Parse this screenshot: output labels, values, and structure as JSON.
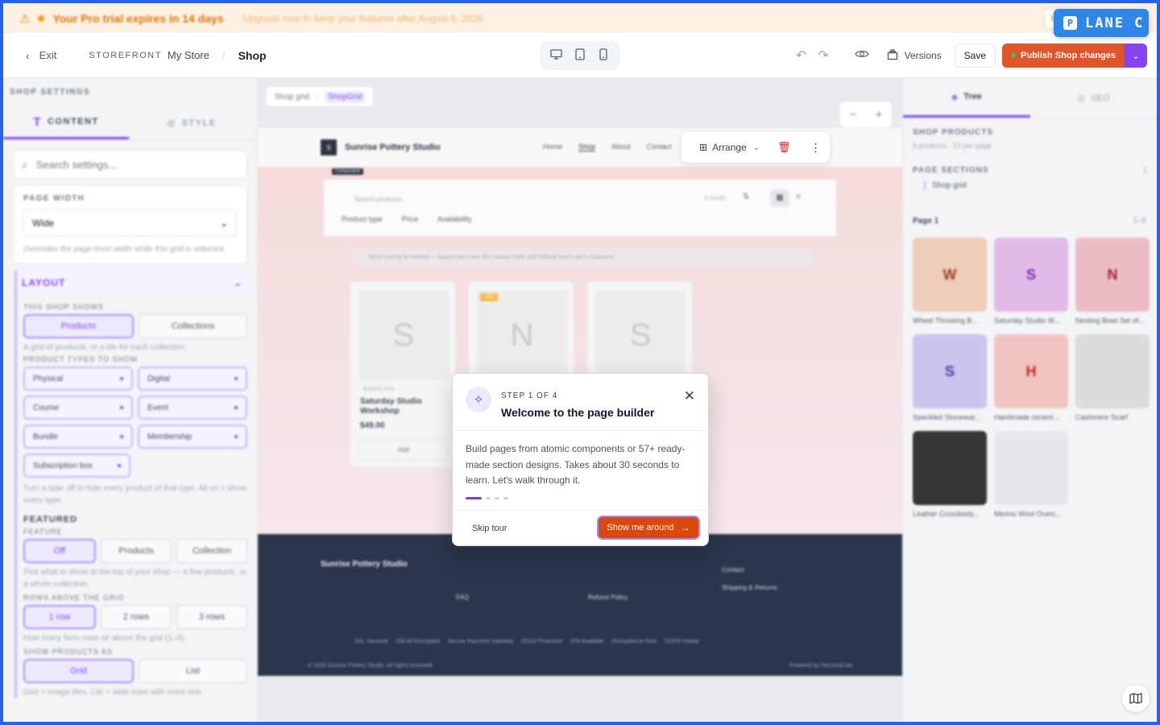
{
  "banner": {
    "message": "Your Pro trial expires in 14 days",
    "sub": "Upgrade now to keep your features after August 6, 2026",
    "upgrade": "Up"
  },
  "lane": {
    "label": "LANE C",
    "icon": "P"
  },
  "topbar": {
    "exit": "Exit",
    "storefront": "STOREFRONT",
    "store": "My Store",
    "page": "Shop",
    "versions": "Versions",
    "save": "Save",
    "publish": "Publish Shop changes"
  },
  "left": {
    "header": "SHOP SETTINGS",
    "tab_content": "CONTENT",
    "tab_style": "STYLE",
    "search_placeholder": "Search settings...",
    "page_width_label": "PAGE WIDTH",
    "page_width_value": "Wide",
    "page_width_hint": "Overrides the page-level width while this grid is selected.",
    "layout_label": "LAYOUT",
    "shows_label": "THIS SHOP SHOWS",
    "shows_options": [
      "Products",
      "Collections"
    ],
    "shows_hint": "A grid of products, or a tile for each collection.",
    "types_label": "PRODUCT TYPES TO SHOW",
    "types": [
      "Physical",
      "Digital",
      "Course",
      "Event",
      "Bundle",
      "Membership",
      "Subscription box"
    ],
    "types_hint": "Turn a type off to hide every product of that type. All on = show every type.",
    "featured_label": "FEATURED",
    "feature_label": "FEATURE",
    "feature_options": [
      "Off",
      "Products",
      "Collection"
    ],
    "feature_hint": "Pick what to show at the top of your shop — a few products, or a whole collection.",
    "rows_label": "ROWS ABOVE THE GRID",
    "rows_options": [
      "1 row",
      "2 rows",
      "3 rows"
    ],
    "rows_hint": "How many hero rows sit above the grid (1–3).",
    "showas_label": "SHOW PRODUCTS AS",
    "showas_options": [
      "Grid",
      "List"
    ],
    "showas_hint": "Grid = image tiles. List = wide rows with more text."
  },
  "canvas": {
    "breadcrumb": [
      "Shop grid",
      "ShopGrid"
    ],
    "zoom_minus": "−",
    "zoom_plus": "+",
    "arrange": "Arrange",
    "site_name": "Sunrise Pottery Studio",
    "site_logo": "S",
    "nav": [
      "Home",
      "Shop",
      "About",
      "Contact"
    ],
    "component_tag": "Component",
    "search_placeholder": "Search products...",
    "results": "3 results",
    "filters": [
      "Product type",
      "Price",
      "Availability"
    ],
    "sort_note": "You're sorting by Newest — buyers won't see this manual order until Default sort is set to Featured.",
    "products": [
      {
        "letter": "S",
        "tag": "BOOKING",
        "title": "Saturday Studio Workshop",
        "price": "$49.00",
        "add": "Add"
      },
      {
        "letter": "N",
        "sale": "-15%"
      },
      {
        "letter": "S"
      }
    ],
    "footer": {
      "name": "Sunrise Pottery Studio",
      "contact": "Contact",
      "shipping": "Shipping & Returns",
      "faq": "FAQ",
      "refund": "Refund Policy",
      "badges": [
        "SSL Secured",
        "256-bit Encrypted",
        "Secure Payment Gateway",
        "DDoS Protected",
        "2FA Available",
        "Encrypted at Rest",
        "GDPR Ready"
      ],
      "copyright": "© 2026 Sunrise Pottery Studio. All rights reserved.",
      "powered": "Powered by PersonaCart"
    }
  },
  "right": {
    "tab_tree": "Tree",
    "tab_seo": "SEO",
    "shop_products": "SHOP PRODUCTS",
    "shop_products_sub": "8 products · 12 per page",
    "page_sections": "PAGE SECTIONS",
    "page_sections_count": "1",
    "section_item": "Shop grid",
    "page_label": "Page 1",
    "page_range": "1–8",
    "thumbs": [
      {
        "letter": "W",
        "caption": "Wheel Throwing B...",
        "bg": "#ecc9b4",
        "fg": "#9a3412"
      },
      {
        "letter": "S",
        "caption": "Saturday Studio W...",
        "bg": "#e0b6e6",
        "fg": "#6b21a8"
      },
      {
        "letter": "N",
        "caption": "Nesting Bowl Set of...",
        "bg": "#eab8c0",
        "fg": "#9f1239"
      },
      {
        "letter": "S",
        "caption": "Speckled Stonewar...",
        "bg": "#c9c0ee",
        "fg": "#3730a3"
      },
      {
        "letter": "H",
        "caption": "Handmade cerami...",
        "bg": "#f0c2bd",
        "fg": "#b91c1c"
      },
      {
        "letter": "",
        "caption": "Cashmere Scarf",
        "bg": "#d9dadc",
        "fg": "#374151"
      },
      {
        "letter": "",
        "caption": "Leather Crossbody...",
        "bg": "#2a2a2a",
        "fg": "#d4a24c"
      },
      {
        "letter": "",
        "caption": "Merino Wool Overc...",
        "bg": "#e4e6ea",
        "fg": "#1e3a5f"
      }
    ]
  },
  "tour": {
    "step": "STEP 1 OF 4",
    "title": "Welcome to the page builder",
    "body": "Build pages from atomic components or 57+ ready-made section designs. Takes about 30 seconds to learn. Let's walk through it.",
    "skip": "Skip tour",
    "cta": "Show me around"
  },
  "colors": {
    "accent": "#7c3aed",
    "cta": "#d9480f",
    "publish": "#e0491c",
    "lane": "#2e86e8"
  }
}
